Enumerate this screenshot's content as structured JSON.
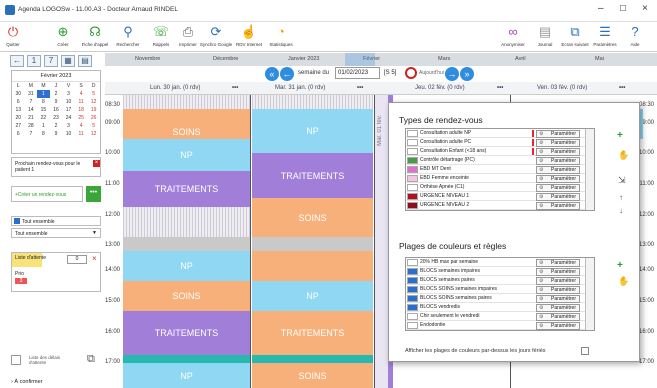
{
  "window": {
    "title": "Agenda LOGOSw - 11.00.A3 - Docteur Arnaud RINDEL"
  },
  "toolbar": {
    "left": [
      {
        "label": "Quitter",
        "icon": "power-icon",
        "color": "#d02a1a"
      },
      {
        "label": "Créer",
        "icon": "plus-circle-icon",
        "color": "#2a9d2a"
      },
      {
        "label": "Fiche d'appel",
        "icon": "headset-icon",
        "color": "#2a9d2a"
      },
      {
        "label": "Rechercher",
        "icon": "search-icon",
        "color": "#2a6fb8"
      },
      {
        "label": "Rappels",
        "icon": "phone-icon",
        "color": "#2a9d2a"
      },
      {
        "label": "Imprimer",
        "icon": "printer-icon",
        "color": "#666"
      },
      {
        "label": "Synchro Google",
        "icon": "sync-icon",
        "color": "#2a6fb8"
      },
      {
        "label": "RDV Internet",
        "icon": "hand-icon",
        "color": "#777"
      },
      {
        "label": "Statistiques",
        "icon": "pie-chart-icon",
        "color": "#f0a020"
      }
    ],
    "right": [
      {
        "label": "Anonymiser",
        "icon": "mask-icon",
        "color": "#b03fc0"
      },
      {
        "label": "Journal",
        "icon": "journal-icon",
        "color": "#999"
      },
      {
        "label": "Ecran suivant",
        "icon": "screens-icon",
        "color": "#2a6fb8"
      },
      {
        "label": "Paramètres",
        "icon": "sliders-icon",
        "color": "#2a6fb8"
      },
      {
        "label": "Aide",
        "icon": "help-icon",
        "color": "#2a6fb8"
      }
    ]
  },
  "months": [
    "Novembre",
    "Décembre",
    "Janvier 2023",
    "Février",
    "Mars",
    "Avril",
    "Mai"
  ],
  "weekbar": {
    "label": "semaine du",
    "date": "01/02/2023",
    "week": "[S 5]",
    "today": "Aujourd'hui"
  },
  "calendar": {
    "title": "Février 2023",
    "days": [
      "L",
      "M",
      "M",
      "J",
      "V",
      "S",
      "D"
    ],
    "rows": [
      [
        "30",
        "31",
        "1",
        "2",
        "3",
        "4",
        "5"
      ],
      [
        "6",
        "7",
        "8",
        "9",
        "10",
        "11",
        "12"
      ],
      [
        "13",
        "14",
        "15",
        "16",
        "17",
        "18",
        "19"
      ],
      [
        "20",
        "21",
        "22",
        "23",
        "24",
        "25",
        "26"
      ],
      [
        "27",
        "28",
        "1",
        "2",
        "3",
        "4",
        "5"
      ],
      [
        "6",
        "7",
        "8",
        "9",
        "10",
        "11",
        "12"
      ]
    ]
  },
  "leftpanel": {
    "next_rdv": "Prochain rendez-vous pour le patient 1",
    "create_rdv": "Créer un rendez-vous",
    "all_label": "Tout ensemble",
    "waitlist": "Liste d'attente",
    "waitlist_count": "0",
    "prio": "Prio",
    "bottom_link": "Liste des délais d'attente",
    "confirm": "À confirmer"
  },
  "days": [
    {
      "label": "Lun. 30 jan. (0 rdv)"
    },
    {
      "label": "Mar. 31 jan. (0 rdv)"
    },
    {
      "label": "Jeu. 02 fév. (0 rdv)"
    },
    {
      "label": "Ven. 03 fév. (0 rdv)"
    }
  ],
  "hours": [
    "08:30",
    "09:00",
    "10:00",
    "11:00",
    "12:00",
    "13:00",
    "14:00",
    "15:00",
    "16:00",
    "17:00"
  ],
  "side_marker": "Mar. 01 fév.",
  "blocks": {
    "soins": "SOINS",
    "np": "NP",
    "traitements": "TRAITEMENTS"
  },
  "popup": {
    "types_title": "Types de rendez-vous",
    "types": [
      {
        "name": "Consultation adulte NP",
        "color": "#ffffff",
        "param": "Paramètrer"
      },
      {
        "name": "Consultation adulte PC",
        "color": "#ffffff",
        "param": "Paramètrer"
      },
      {
        "name": "Consultation Enfant (<18 ans)",
        "color": "#ffffff",
        "param": "Paramètrer"
      },
      {
        "name": "Contrôle détartrage (PC)",
        "color": "#4a9a4a",
        "param": "Paramètrer"
      },
      {
        "name": "EBD MT Dent",
        "color": "#e070d0",
        "param": "Paramètrer"
      },
      {
        "name": "EBD Femme enceinte",
        "color": "#f4c6e6",
        "param": "Paramètrer"
      },
      {
        "name": "Orthèse Apnée (C1)",
        "color": "#ffffff",
        "param": "Paramètrer"
      },
      {
        "name": "URGENCE NIVEAU 1",
        "color": "#b01020",
        "param": "Paramètrer"
      },
      {
        "name": "URGENCE NIVEAU 2",
        "color": "#8a1020",
        "param": "Paramètrer"
      }
    ],
    "plages_title": "Plages de couleurs et règles",
    "plages": [
      {
        "name": "20% HB max par semaine",
        "color": "#ffffff",
        "param": "Paramètrer"
      },
      {
        "name": "BLOCS semaines impaires",
        "color": "#2a6fd0",
        "param": "Paramètrer"
      },
      {
        "name": "BLOCS semaines paires",
        "color": "#2a6fd0",
        "param": "Paramètrer"
      },
      {
        "name": "BLOCS SOINS semaines impaires",
        "color": "#2a6fd0",
        "param": "Paramètrer"
      },
      {
        "name": "BLOCS SOINS semaines paires",
        "color": "#2a6fd0",
        "param": "Paramètrer"
      },
      {
        "name": "BLOCS vendredis",
        "color": "#2a6fd0",
        "param": "Paramètrer"
      },
      {
        "name": "Chir seulement le vendredi",
        "color": "#ffffff",
        "param": "Paramètrer"
      },
      {
        "name": "Endodontie",
        "color": "#ffffff",
        "param": "Paramètrer"
      }
    ],
    "footer": "Afficher les plages de couleurs par-dessus les jours fériés"
  }
}
